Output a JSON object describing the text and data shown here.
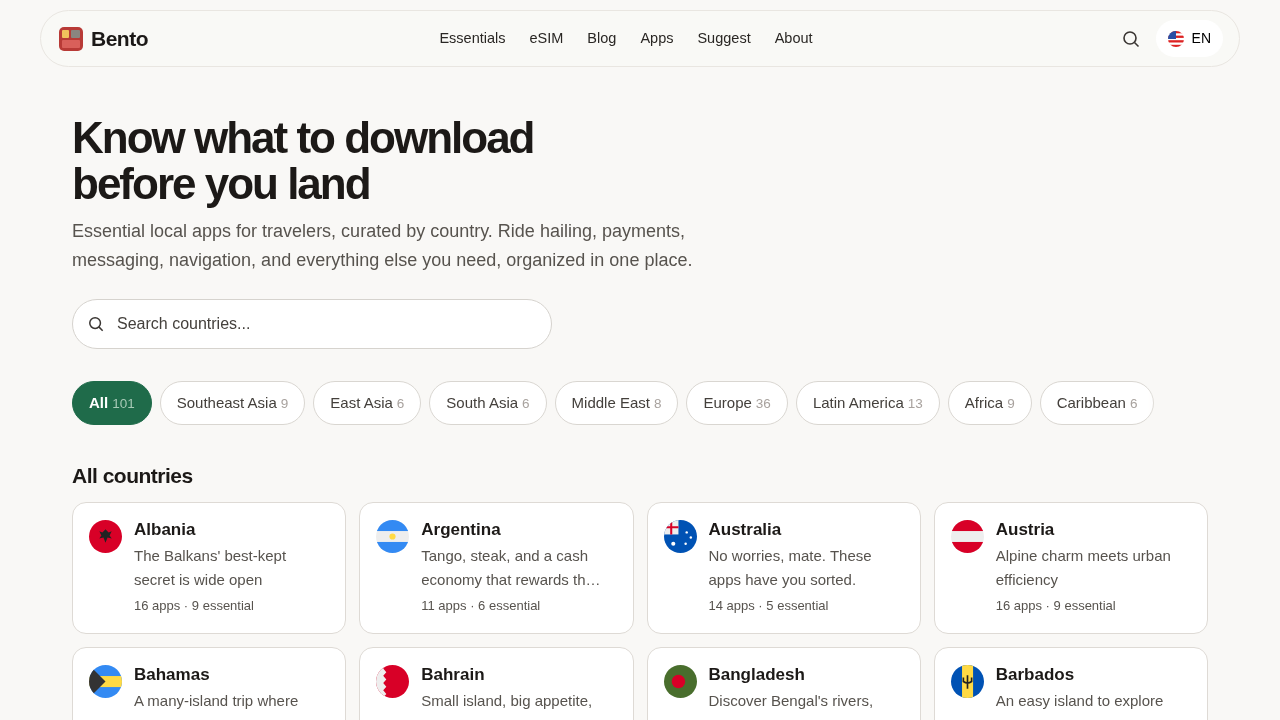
{
  "brand": {
    "name": "Bento"
  },
  "nav": [
    "Essentials",
    "eSIM",
    "Blog",
    "Apps",
    "Suggest",
    "About"
  ],
  "language": {
    "label": "EN"
  },
  "hero": {
    "title": "Know what to download before you land",
    "subtitle": "Essential local apps for travelers, curated by country. Ride hailing, payments, messaging, navigation, and everything else you need, organized in one place."
  },
  "search": {
    "placeholder": "Search countries..."
  },
  "regions": [
    {
      "label": "All",
      "count": "101",
      "selected": true
    },
    {
      "label": "Southeast Asia",
      "count": "9",
      "selected": false
    },
    {
      "label": "East Asia",
      "count": "6",
      "selected": false
    },
    {
      "label": "South Asia",
      "count": "6",
      "selected": false
    },
    {
      "label": "Middle East",
      "count": "8",
      "selected": false
    },
    {
      "label": "Europe",
      "count": "36",
      "selected": false
    },
    {
      "label": "Latin America",
      "count": "13",
      "selected": false
    },
    {
      "label": "Africa",
      "count": "9",
      "selected": false
    },
    {
      "label": "Caribbean",
      "count": "6",
      "selected": false
    }
  ],
  "section_title": "All countries",
  "countries": [
    {
      "name": "Albania",
      "description": "The Balkans' best-kept secret is wide open",
      "meta": "16 apps · 9 essential"
    },
    {
      "name": "Argentina",
      "description": "Tango, steak, and a cash economy that rewards th…",
      "meta": "11 apps · 6 essential"
    },
    {
      "name": "Australia",
      "description": "No worries, mate. These apps have you sorted.",
      "meta": "14 apps · 5 essential"
    },
    {
      "name": "Austria",
      "description": "Alpine charm meets urban efficiency",
      "meta": "16 apps · 9 essential"
    },
    {
      "name": "Bahamas",
      "description": "A many-island trip where"
    },
    {
      "name": "Bahrain",
      "description": "Small island, big appetite,"
    },
    {
      "name": "Bangladesh",
      "description": "Discover Bengal's rivers,"
    },
    {
      "name": "Barbados",
      "description": "An easy island to explore"
    }
  ]
}
